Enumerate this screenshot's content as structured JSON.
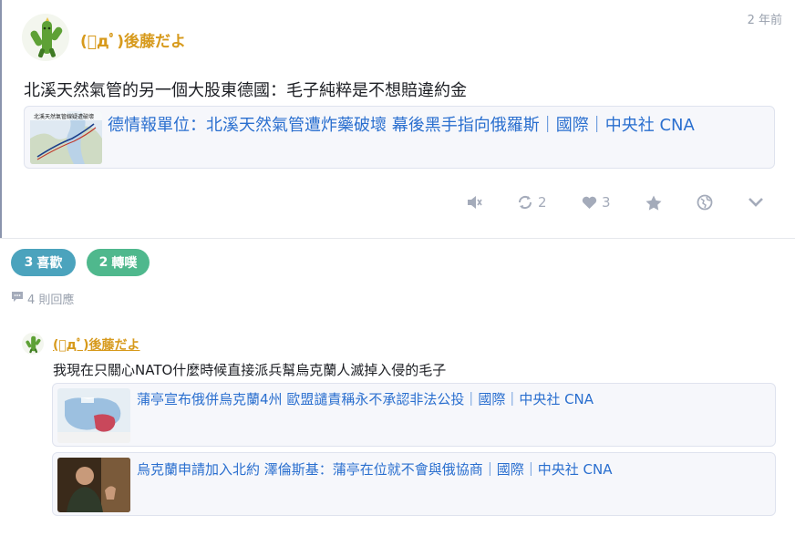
{
  "post": {
    "author": "(ﾟдﾟ)後藤だよ",
    "time": "2 年前",
    "text": "北溪天然氣管的另一個大股東德國：毛子純粹是不想賠違約金",
    "link": {
      "title": "德情報單位：北溪天然氣管遭炸藥破壞 幕後黑手指向俄羅斯｜國際｜中央社 CNA",
      "thumb_caption": "北溪天然氣管線疑遭破壞"
    },
    "actions": {
      "repost_count": "2",
      "like_count": "3"
    }
  },
  "stats": {
    "likes_count": "3",
    "likes_label": "喜歡",
    "reposts_count": "2",
    "reposts_label": "轉噗",
    "replies_label": "4 則回應"
  },
  "reply": {
    "author": "(ﾟдﾟ)後藤だよ",
    "text": "我現在只關心NATO什麼時候直接派兵幫烏克蘭人滅掉入侵的毛子",
    "links": [
      {
        "title": "蒲亭宣布俄併烏克蘭4州 歐盟譴責稱永不承認非法公投｜國際｜中央社 CNA"
      },
      {
        "title": "烏克蘭申請加入北約 澤倫斯基：蒲亭在位就不會與俄協商｜國際｜中央社 CNA"
      }
    ]
  },
  "colors": {
    "author": "#d79a1c",
    "link": "#2a6fcf",
    "likes_pill": "#4ba3bd",
    "reposts_pill": "#4fb88d",
    "muted": "#a4abba"
  },
  "icons": {
    "avatar": "cactus-icon",
    "mute": "speaker-mute-icon",
    "repost": "repost-arrows-icon",
    "like": "heart-icon",
    "favorite": "star-icon",
    "globe": "globe-icon",
    "more": "chevron-down-icon",
    "replies": "speech-bubble-icon"
  }
}
